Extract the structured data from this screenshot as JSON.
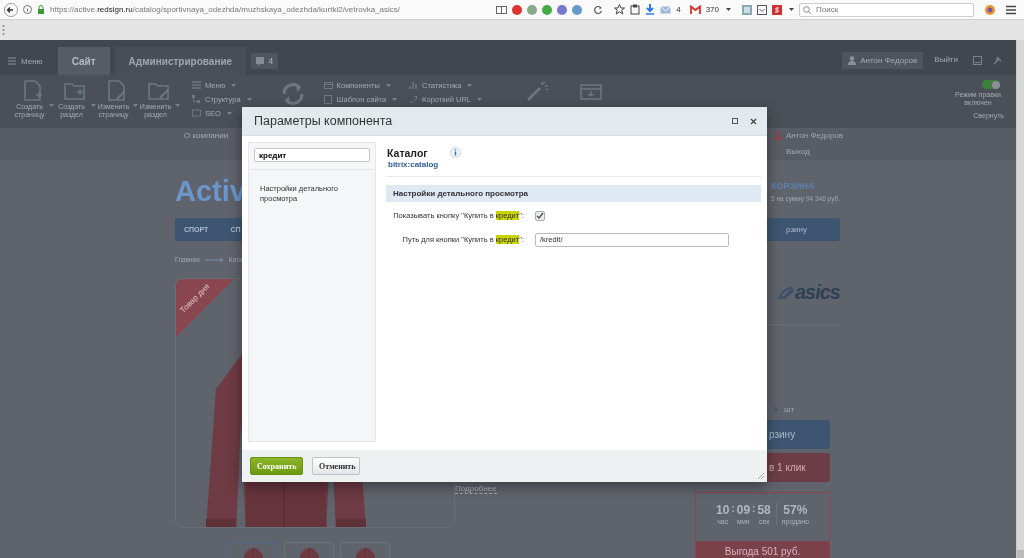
{
  "browser": {
    "url": {
      "scheme": "https://active.",
      "domain": "redsign.ru",
      "path": "/catalog/sportivnaya_odezhda/muzhskaya_odezhda/kurtki2/vetrovka_asics/"
    },
    "mail_count": "4",
    "gmail_count": "370",
    "search_placeholder": "Поиск"
  },
  "admin": {
    "menu": "Меню",
    "tabs": [
      {
        "label": "Сайт",
        "selected": true
      },
      {
        "label": "Администрирование",
        "selected": false
      }
    ],
    "notifications": "4",
    "user": "Антон Федоров",
    "logout": "Выйти",
    "actions": [
      {
        "label": "Создать страницу",
        "kind": "page-add"
      },
      {
        "label": "Создать раздел",
        "kind": "folder-add"
      },
      {
        "label": "Изменить страницу",
        "kind": "page-edit"
      },
      {
        "label": "Изменить раздел",
        "kind": "folder-edit"
      }
    ],
    "menu_groups": [
      {
        "items": [
          "Меню",
          "Структура",
          "SEO"
        ]
      },
      {
        "items": [
          "Компоненты",
          "Шаблон сайта"
        ]
      },
      {
        "items": [
          "Статистика",
          "Короткий URL"
        ]
      }
    ],
    "edit_mode": {
      "label": "Режим правки включен",
      "on": true
    },
    "collapse": "Свернуть"
  },
  "site": {
    "top_link": "О компании",
    "user": "Антон Федоров",
    "logout": "Выход",
    "logo": "Activ",
    "basket_title": "КОРЗИНА",
    "basket_summary": "5 на сумму 94 346 руб.",
    "nav": [
      "СПОРТ",
      "СП"
    ],
    "nav_button": "рзину",
    "breadcrumbs": [
      "Главная",
      "Ката"
    ],
    "ribbon": "Товар дня",
    "more_link": "Подробнее",
    "brand": "asics",
    "quantity_unit": "шт",
    "cart_button": "рзину",
    "one_click_button": "в 1 клик",
    "timer": [
      {
        "kind": "digit",
        "value": "10",
        "unit": "час"
      },
      {
        "kind": "sep",
        "value": ":"
      },
      {
        "kind": "digit",
        "value": "09",
        "unit": "мин"
      },
      {
        "kind": "sep",
        "value": ":"
      },
      {
        "kind": "digit",
        "value": "58",
        "unit": "сек"
      },
      {
        "kind": "divider"
      },
      {
        "kind": "digit",
        "value": "57%",
        "unit": "продано"
      }
    ],
    "benefit": "Выгода 501 руб.",
    "thumbnails": [
      {
        "selected": true
      },
      {
        "selected": false
      },
      {
        "selected": false
      }
    ]
  },
  "dialog": {
    "title": "Параметры компонента",
    "search_value": "кредит",
    "sections": [
      "Настройки детального просмотра"
    ],
    "component_name": "Каталог",
    "component_id": "bitrix:catalog",
    "group": "Настройки детального просмотра",
    "fields": [
      {
        "kind": "checkbox",
        "label": {
          "before": "Показывать кнопку \"Купить в ",
          "highlight": "кредит",
          "after": "\":"
        },
        "checked": true
      },
      {
        "kind": "text",
        "label": {
          "before": "Путь для кнопки \"Купить в ",
          "highlight": "кредит",
          "after": "\":"
        },
        "value": "/kredit/"
      }
    ],
    "save": "Сохранить",
    "cancel": "Отменить"
  }
}
